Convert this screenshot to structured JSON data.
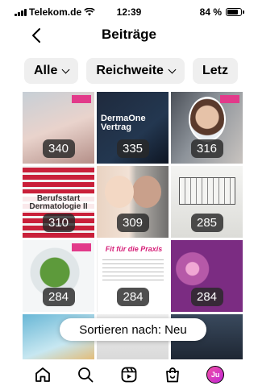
{
  "status_bar": {
    "carrier": "Telekom.de",
    "time": "12:39",
    "battery": "84 %",
    "battery_level": 0.84
  },
  "header": {
    "title": "Beiträge"
  },
  "filters": [
    {
      "label": "Alle",
      "has_chevron": true
    },
    {
      "label": "Reichweite",
      "has_chevron": true
    },
    {
      "label": "Letz",
      "has_chevron": false
    }
  ],
  "tiles": [
    {
      "count": "340",
      "text": ""
    },
    {
      "count": "335",
      "text": "DermaOne Vertrag"
    },
    {
      "count": "316",
      "text": ""
    },
    {
      "count": "310",
      "text": "Berufsstart Dermatologie II"
    },
    {
      "count": "309",
      "text": ""
    },
    {
      "count": "285",
      "text": ""
    },
    {
      "count": "284",
      "text": ""
    },
    {
      "count": "284",
      "text": "Fit für die Praxis"
    },
    {
      "count": "284",
      "text": ""
    },
    {
      "count": "",
      "text": ""
    },
    {
      "count": "",
      "text": ""
    },
    {
      "count": "",
      "text": ""
    }
  ],
  "sort": {
    "label": "Sortieren nach: Neu"
  },
  "tab_bar": {
    "items": [
      "home-icon",
      "search-icon",
      "reels-icon",
      "shop-icon",
      "profile-avatar"
    ],
    "avatar_initials": "Ju"
  }
}
